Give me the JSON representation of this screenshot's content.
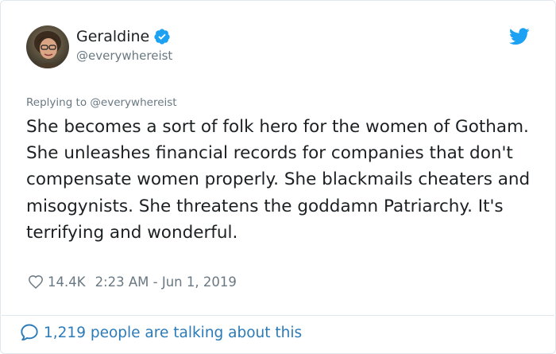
{
  "author": {
    "display_name": "Geraldine",
    "handle": "@everywhereist"
  },
  "tweet": {
    "reply_to": "Replying to @everywhereist",
    "text": "She becomes a sort of folk hero for the women of Gotham. She unleashes financial records for companies that don't compensate women properly. She blackmails cheaters and misogynists. She threatens the goddamn Patriarchy. It's terrifying and wonderful.",
    "likes": "14.4K",
    "timestamp": "2:23 AM - Jun 1, 2019"
  },
  "footer": {
    "conversation": "1,219 people are talking about this"
  },
  "icons": {
    "verified": "verified-badge-icon",
    "brand": "twitter-bird-icon",
    "like": "heart-icon",
    "conversation": "speech-bubble-icon"
  },
  "colors": {
    "link": "#2b7bb9",
    "twitter_blue": "#1da1f2",
    "muted": "#697882",
    "text": "#1c2022",
    "border": "#e1e8ed"
  }
}
